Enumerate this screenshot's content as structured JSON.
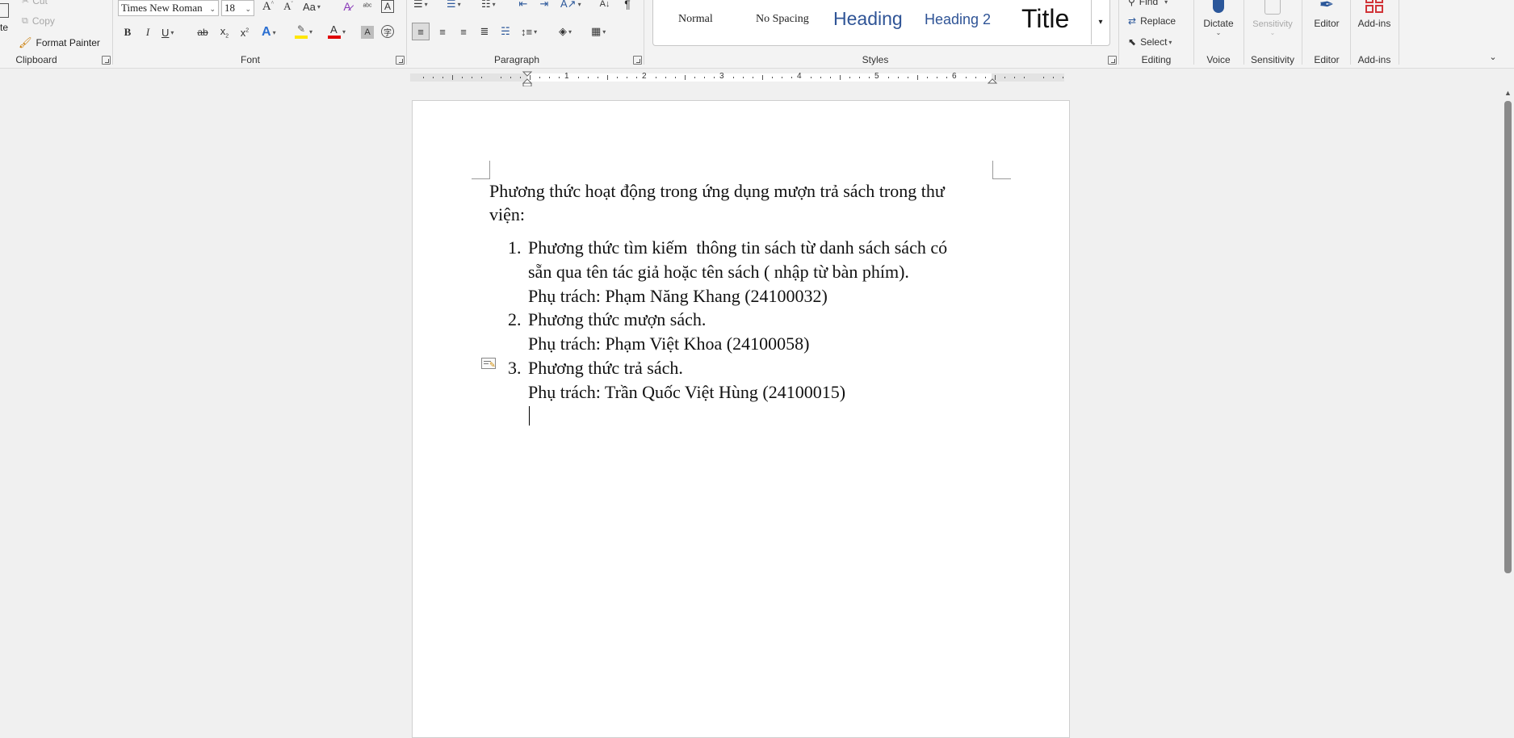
{
  "clipboard": {
    "cut": "Cut",
    "copy": "Copy",
    "format_painter": "Format Painter",
    "group": "Clipboard",
    "paste_partial": "te"
  },
  "font": {
    "name": "Times New Roman",
    "size": "18",
    "group": "Font",
    "change_case": "Aa"
  },
  "paragraph": {
    "group": "Paragraph"
  },
  "styles": {
    "group": "Styles",
    "items": [
      "Normal",
      "No Spacing",
      "Heading",
      "Heading 2",
      "Title"
    ]
  },
  "editing": {
    "find": "Find",
    "replace": "Replace",
    "select": "Select",
    "group": "Editing"
  },
  "voice": {
    "dictate": "Dictate",
    "group": "Voice"
  },
  "sensitivity": {
    "label": "Sensitivity",
    "group": "Sensitivity"
  },
  "editor": {
    "label": "Editor",
    "group": "Editor"
  },
  "addins": {
    "label": "Add-ins",
    "group": "Add-ins"
  },
  "ruler": {
    "numbers": [
      "1",
      "2",
      "3",
      "4",
      "5",
      "6"
    ]
  },
  "document": {
    "intro_line1": "Phương thức hoạt động trong ứng dụng mượn trả sách trong thư",
    "intro_line2": "viện:",
    "items": [
      {
        "num": "1.",
        "line1": "Phương thức tìm kiếm  thông tin sách từ danh sách sách có",
        "line2": "sẵn qua tên tác giả hoặc tên sách ( nhập từ bàn phím).",
        "owner": "Phụ trách: Phạm Năng Khang (24100032)"
      },
      {
        "num": "2.",
        "line1": "Phương thức mượn sách.",
        "owner": "Phụ trách: Phạm Việt Khoa (24100058)"
      },
      {
        "num": "3.",
        "line1": "Phương thức trả sách.",
        "owner": "Phụ trách: Trần Quốc Việt Hùng (24100015)"
      }
    ]
  },
  "colors": {
    "accent": "#2b579a",
    "highlight_yellow": "#ffe600",
    "font_red": "#e00000",
    "heading_blue": "#2f5496",
    "addins_red": "#d13438"
  }
}
